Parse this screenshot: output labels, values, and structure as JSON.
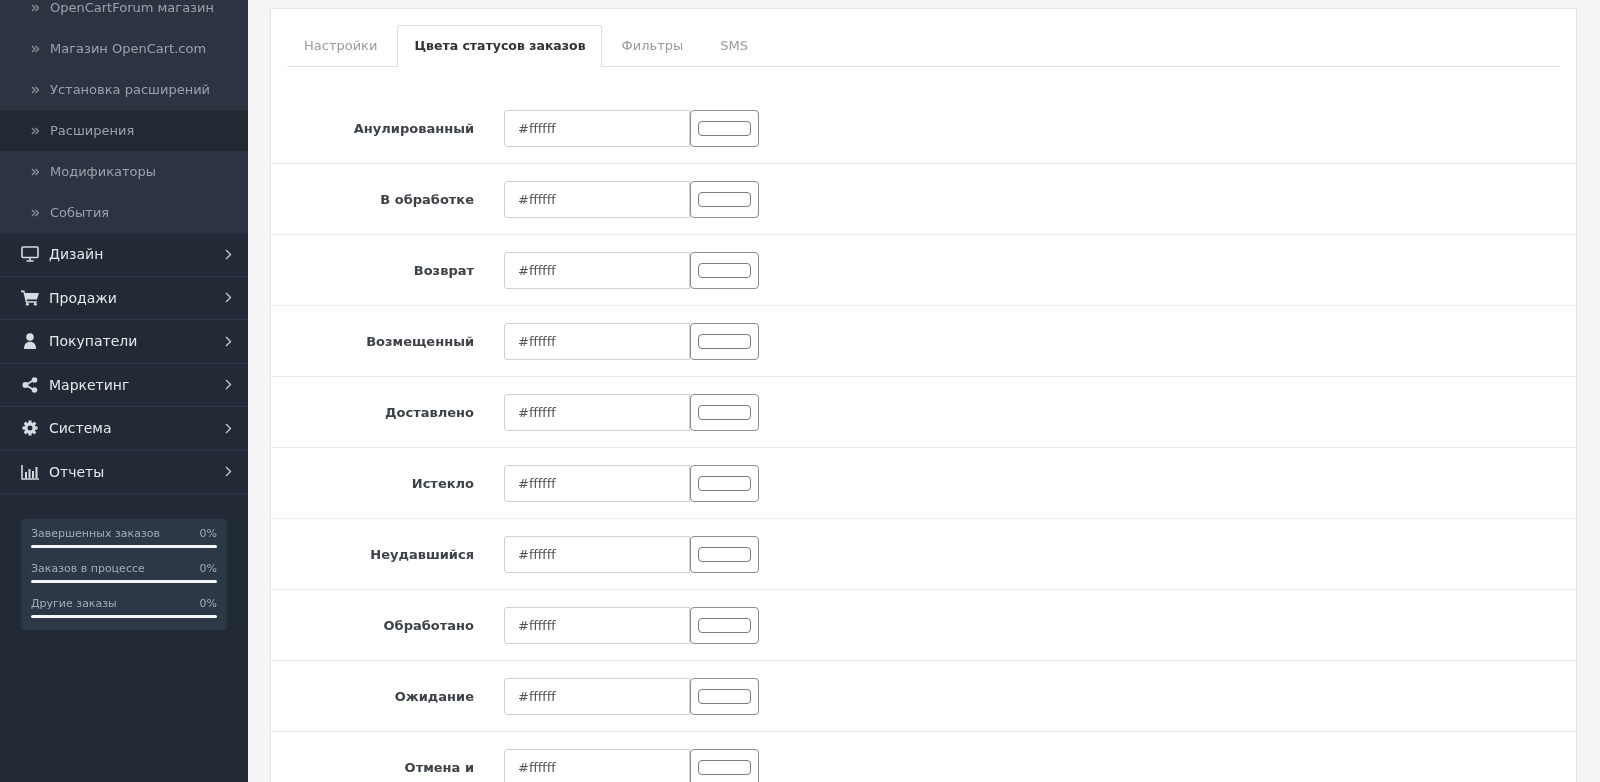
{
  "sidebar": {
    "submenu_items": [
      {
        "label": "OpenCartForum магазин",
        "selected": false
      },
      {
        "label": "Магазин OpenCart.com",
        "selected": false
      },
      {
        "label": "Установка расширений",
        "selected": false
      },
      {
        "label": "Расширения",
        "selected": true
      },
      {
        "label": "Модификаторы",
        "selected": false
      },
      {
        "label": "События",
        "selected": false
      }
    ],
    "menu_items": [
      {
        "label": "Дизайн",
        "expanded": false
      },
      {
        "label": "Продажи",
        "expanded": false
      },
      {
        "label": "Покупатели",
        "expanded": false
      },
      {
        "label": "Маркетинг",
        "expanded": false
      },
      {
        "label": "Система",
        "expanded": false
      },
      {
        "label": "Отчеты",
        "expanded": false
      }
    ],
    "stats": [
      {
        "label": "Завершенных заказов",
        "value": "0%",
        "level": 0
      },
      {
        "label": "Заказов в процессе",
        "value": "0%",
        "level": 0
      },
      {
        "label": "Другие заказы",
        "value": "0%",
        "level": 0
      }
    ]
  },
  "tabs": [
    {
      "label": "Настройки",
      "selected": false
    },
    {
      "label": "Цвета статусов заказов",
      "selected": true
    },
    {
      "label": "Фильтры",
      "selected": false
    },
    {
      "label": "SMS",
      "selected": false
    }
  ],
  "order_status_colors": [
    {
      "label": "Анулированный",
      "value": "#ffffff"
    },
    {
      "label": "В обработке",
      "value": "#ffffff"
    },
    {
      "label": "Возврат",
      "value": "#ffffff"
    },
    {
      "label": "Возмещенный",
      "value": "#ffffff"
    },
    {
      "label": "Доставлено",
      "value": "#ffffff"
    },
    {
      "label": "Истекло",
      "value": "#ffffff"
    },
    {
      "label": "Неудавшийся",
      "value": "#ffffff"
    },
    {
      "label": "Обработано",
      "value": "#ffffff"
    },
    {
      "label": "Ожидание",
      "value": "#ffffff"
    },
    {
      "label": "Отмена и",
      "value": "#ffffff"
    }
  ]
}
